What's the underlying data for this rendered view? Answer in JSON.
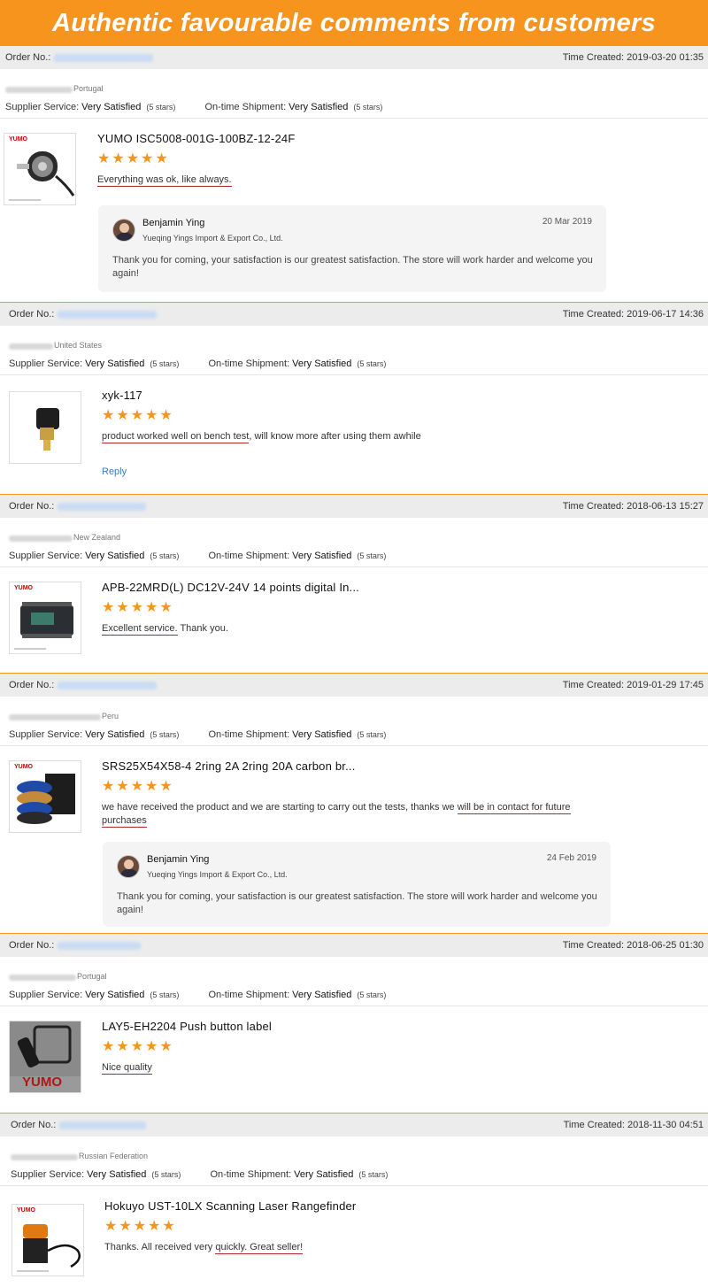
{
  "banner": {
    "title": "Authentic favourable comments from customers"
  },
  "labels": {
    "order_no": "Order No.:",
    "time_created": "Time Created:",
    "supplier_service": "Supplier Service:",
    "ontime_shipment": "On-time Shipment:",
    "very_satisfied": "Very Satisfied",
    "five_stars": "(5 stars)",
    "reply": "Reply",
    "star_glyph": "★"
  },
  "reply_author": {
    "name": "Benjamin Ying",
    "company": "Yueqing Yings Import & Export Co., Ltd.",
    "text": "Thank you for coming, your satisfaction is our greatest satisfaction. The store will work harder and welcome you again!"
  },
  "orders": [
    {
      "time": "2019-03-20 01:35",
      "country": "Portugal",
      "product": "YUMO ISC5008-001G-100BZ-12-24F",
      "comment_ul": "Everything was ok, like always.",
      "comment_rest": "",
      "reply_date": "20 Mar 2019"
    },
    {
      "time": "2019-06-17 14:36",
      "country": "United States",
      "product": "xyk-117",
      "comment_ul": "product worked well on bench test",
      "comment_rest": ", will know more after using them awhile"
    },
    {
      "time": "2018-06-13 15:27",
      "country": "New Zealand",
      "product": "APB-22MRD(L) DC12V-24V 14 points digital In...",
      "comment_ul": "Excellent service.",
      "comment_rest": " Thank you."
    },
    {
      "time": "2019-01-29 17:45",
      "country": "Peru",
      "product": "SRS25X54X58-4 2ring 2A 2ring 20A carbon br...",
      "comment_pre": "we have received the product and we are starting to carry out the tests, thanks we ",
      "comment_ul": "will be in contact for future purchases",
      "reply_date": "24 Feb 2019"
    },
    {
      "time": "2018-06-25 01:30",
      "country": "Portugal",
      "product": "LAY5-EH2204 Push button label",
      "comment_ul": "Nice quality",
      "comment_rest": "",
      "thumb_logo": "YUMO"
    },
    {
      "time": "2018-11-30 04:51",
      "country": "Russian Federation",
      "product": "Hokuyo UST-10LX Scanning Laser Rangefinder",
      "comment_pre": "Thanks. All received very ",
      "comment_ul": "quickly. Great seller!",
      "comment_rest": ""
    }
  ],
  "thumb": {
    "logo_small": "YUMO"
  }
}
